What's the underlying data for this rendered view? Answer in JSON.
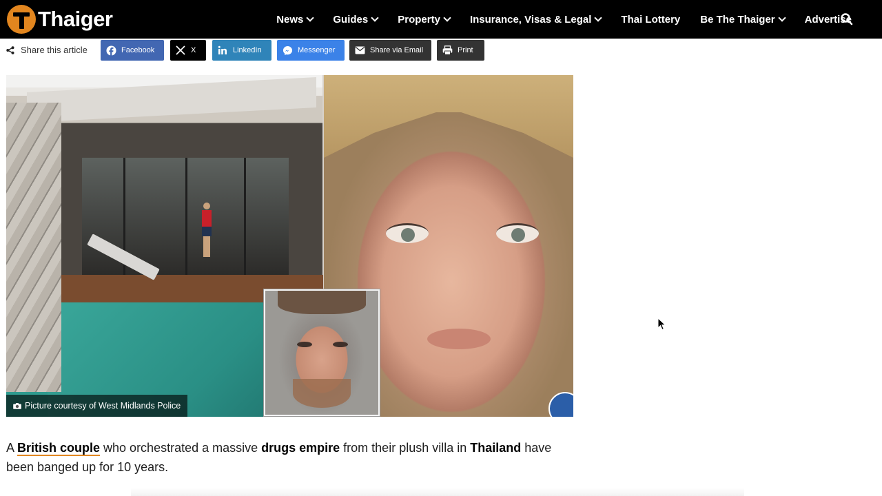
{
  "header": {
    "logo_text": "Thaiger",
    "nav": [
      {
        "label": "News",
        "dropdown": true
      },
      {
        "label": "Guides",
        "dropdown": true
      },
      {
        "label": "Property",
        "dropdown": true
      },
      {
        "label": "Insurance, Visas & Legal",
        "dropdown": true
      },
      {
        "label": "Thai Lottery",
        "dropdown": false
      },
      {
        "label": "Be The Thaiger",
        "dropdown": true
      },
      {
        "label": "Advertise",
        "dropdown": false
      }
    ],
    "search_icon": "search-icon"
  },
  "share": {
    "label": "Share this article",
    "buttons": [
      {
        "label": "Facebook",
        "icon": "facebook-icon",
        "color": "#4267b2"
      },
      {
        "label": "X",
        "icon": "x-icon",
        "color": "#000000"
      },
      {
        "label": "LinkedIn",
        "icon": "linkedin-icon",
        "color": "#2f84b9"
      },
      {
        "label": "Messenger",
        "icon": "messenger-icon",
        "color": "#3b82e8"
      },
      {
        "label": "Share via Email",
        "icon": "email-icon",
        "color": "#333333"
      },
      {
        "label": "Print",
        "icon": "print-icon",
        "color": "#333333"
      }
    ]
  },
  "hero": {
    "caption": "Picture courtesy of West Midlands Police",
    "caption_icon": "camera-icon"
  },
  "article": {
    "p1_prefix": "A ",
    "p1_link": "British couple",
    "p1_mid1": " who orchestrated a massive ",
    "p1_bold1": "drugs empire",
    "p1_mid2": " from their plush villa in ",
    "p1_bold2": "Thailand",
    "p1_suffix": " have been banged up for 10 years."
  },
  "colors": {
    "brand_orange": "#e2861f",
    "header_bg": "#000000"
  }
}
